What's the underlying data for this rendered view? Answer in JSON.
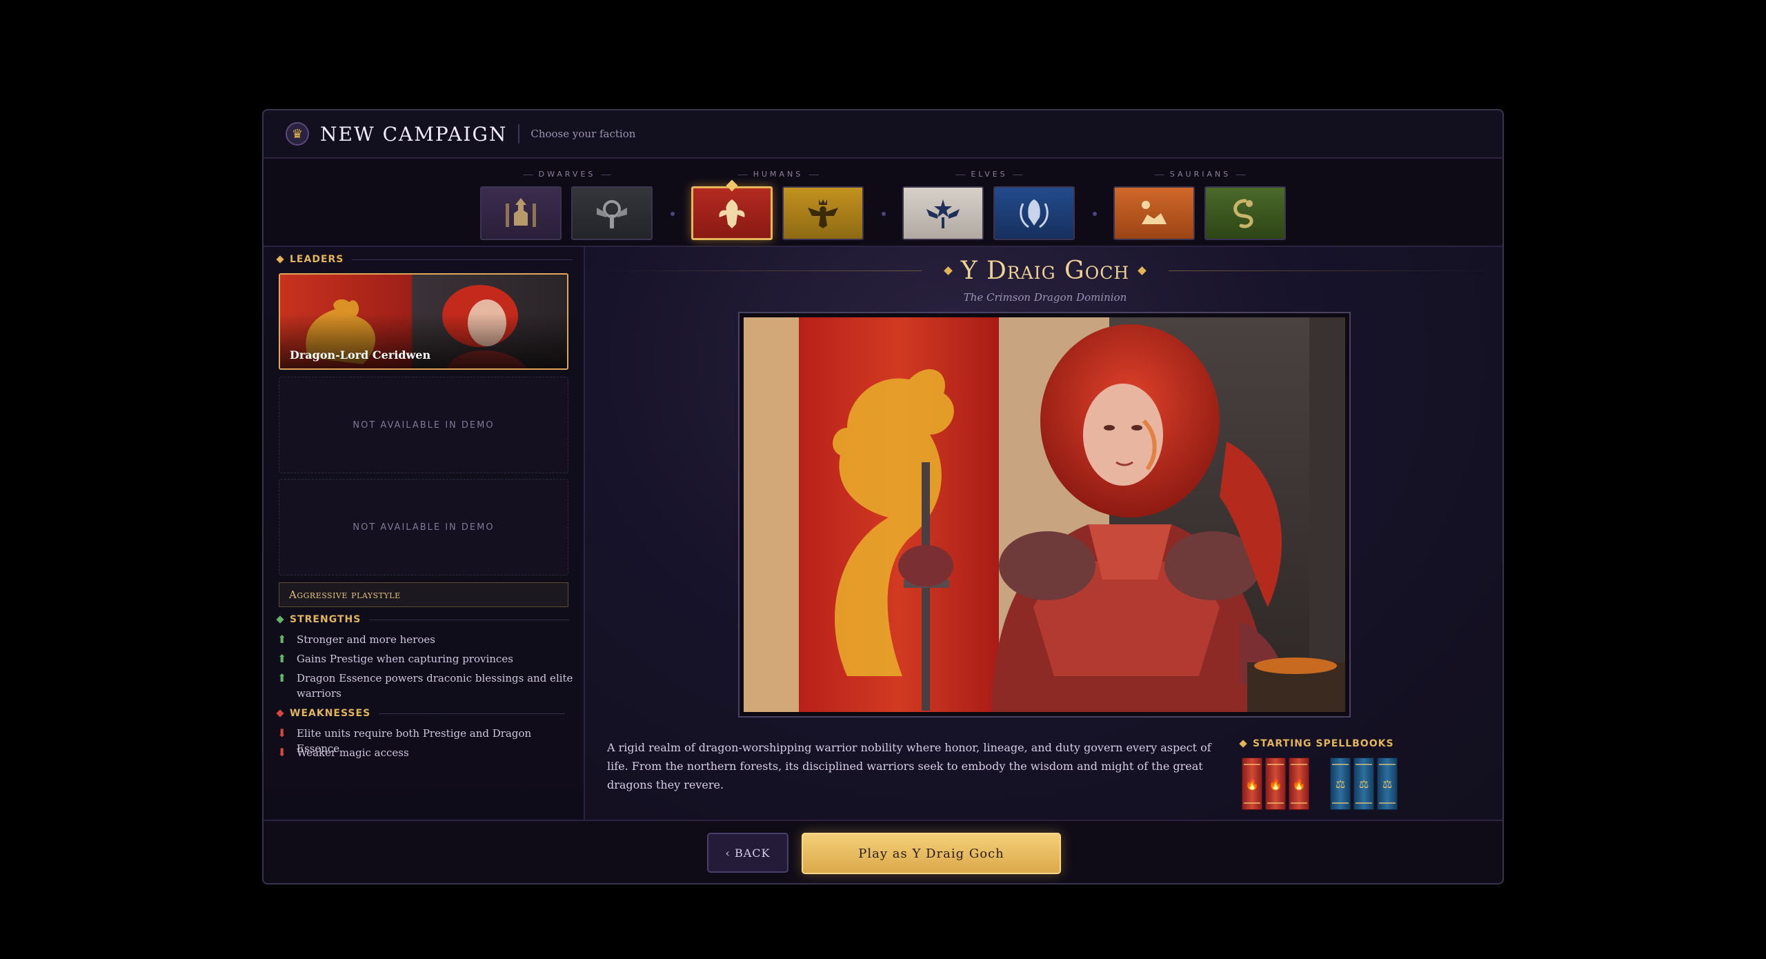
{
  "header": {
    "icon": "crown-icon",
    "title": "NEW CAMPAIGN",
    "subtitle": "Choose your faction"
  },
  "factions": {
    "groups": [
      "DWARVES",
      "HUMANS",
      "ELVES",
      "SAURIANS"
    ],
    "cards": [
      {
        "group": "DWARVES",
        "icon": "dwarf-king-emblem-icon",
        "color": "#3a2a4a",
        "selected": false
      },
      {
        "group": "DWARVES",
        "icon": "dwarf-gear-emblem-icon",
        "color": "#2d2e33",
        "selected": false
      },
      {
        "group": "HUMANS",
        "icon": "red-dragon-emblem-icon",
        "color": "#a8231c",
        "selected": true
      },
      {
        "group": "HUMANS",
        "icon": "eagle-crown-emblem-icon",
        "color": "#b8881c",
        "selected": false
      },
      {
        "group": "ELVES",
        "icon": "winged-star-emblem-icon",
        "color": "#c9c2bb",
        "selected": false
      },
      {
        "group": "ELVES",
        "icon": "laurel-helm-emblem-icon",
        "color": "#1f3d78",
        "selected": false
      },
      {
        "group": "SAURIANS",
        "icon": "sun-moon-emblem-icon",
        "color": "#c25a1c",
        "selected": false
      },
      {
        "group": "SAURIANS",
        "icon": "serpent-emblem-icon",
        "color": "#3d5a22",
        "selected": false
      }
    ]
  },
  "leaders": {
    "heading": "LEADERS",
    "selected_name": "Dragon-Lord Ceridwen",
    "unavailable": [
      "NOT AVAILABLE IN DEMO",
      "NOT AVAILABLE IN DEMO"
    ]
  },
  "playstyle": "Aggressive playstyle",
  "strengths": {
    "heading": "STRENGTHS",
    "items": [
      "Stronger and more heroes",
      "Gains Prestige when capturing provinces",
      "Dragon Essence powers draconic blessings and elite warriors"
    ]
  },
  "weaknesses": {
    "heading": "WEAKNESSES",
    "items": [
      "Elite units require both Prestige and Dragon Essence",
      "Weaker magic access"
    ]
  },
  "faction": {
    "name": "Y Draig Goch",
    "tagline": "The Crimson Dragon Dominion",
    "description": "A rigid realm of dragon-worshipping warrior nobility where honor, lineage, and duty govern every aspect of life. From the northern forests, its disciplined warriors seek to embody the wisdom and might of the great dragons they revere."
  },
  "spellbooks": {
    "heading": "STARTING SPELLBOOKS",
    "books": [
      {
        "school": "fire",
        "icon": "flame-icon"
      },
      {
        "school": "fire",
        "icon": "flame-icon"
      },
      {
        "school": "fire",
        "icon": "flame-icon"
      },
      {
        "school": "order",
        "icon": "scales-icon"
      },
      {
        "school": "order",
        "icon": "scales-icon"
      },
      {
        "school": "order",
        "icon": "scales-icon"
      }
    ]
  },
  "footer": {
    "back_label": "‹ BACK",
    "play_label": "Play as Y Draig Goch"
  },
  "colors": {
    "accent_gold": "#e3b55a",
    "panel_bg": "#120f1e",
    "strength_green": "#67b36a",
    "weakness_red": "#d0483e"
  }
}
